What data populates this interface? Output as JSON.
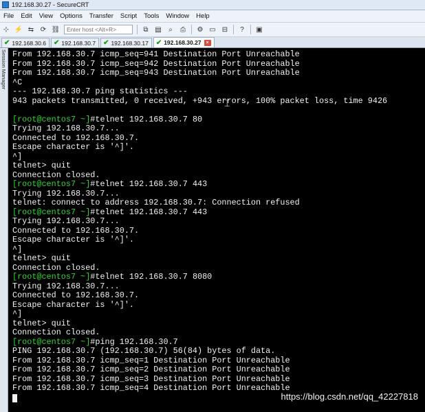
{
  "window": {
    "title": "192.168.30.27 - SecureCRT"
  },
  "menu": [
    "File",
    "Edit",
    "View",
    "Options",
    "Transfer",
    "Script",
    "Tools",
    "Window",
    "Help"
  ],
  "toolbar": {
    "host_placeholder": "Enter host <Alt+R>"
  },
  "tabs": [
    {
      "label": "192.168.30.6",
      "active": false
    },
    {
      "label": "192.168.30.7",
      "active": false
    },
    {
      "label": "192.168.30.17",
      "active": false
    },
    {
      "label": "192.168.30.27",
      "active": true
    }
  ],
  "sidebar": {
    "label": "Session Manager"
  },
  "terminal": {
    "lines": [
      {
        "text": "From 192.168.30.7 icmp_seq=941 Destination Port Unreachable"
      },
      {
        "text": "From 192.168.30.7 icmp_seq=942 Destination Port Unreachable"
      },
      {
        "text": "From 192.168.30.7 icmp_seq=943 Destination Port Unreachable"
      },
      {
        "text": "^C"
      },
      {
        "text": "--- 192.168.30.7 ping statistics ---"
      },
      {
        "text": "943 packets transmitted, 0 received, +943 errors, 100% packet loss, time 9426"
      },
      {
        "text": ""
      },
      {
        "prompt": "[root@centos7 ~]",
        "text": "#telnet 192.168.30.7 80"
      },
      {
        "text": "Trying 192.168.30.7..."
      },
      {
        "text": "Connected to 192.168.30.7."
      },
      {
        "text": "Escape character is '^]'."
      },
      {
        "text": "^]"
      },
      {
        "text": "telnet> quit"
      },
      {
        "text": "Connection closed."
      },
      {
        "prompt": "[root@centos7 ~]",
        "text": "#telnet 192.168.30.7 443"
      },
      {
        "text": "Trying 192.168.30.7..."
      },
      {
        "text": "telnet: connect to address 192.168.30.7: Connection refused"
      },
      {
        "prompt": "[root@centos7 ~]",
        "text": "#telnet 192.168.30.7 443"
      },
      {
        "text": "Trying 192.168.30.7..."
      },
      {
        "text": "Connected to 192.168.30.7."
      },
      {
        "text": "Escape character is '^]'."
      },
      {
        "text": "^]"
      },
      {
        "text": "telnet> quit"
      },
      {
        "text": "Connection closed."
      },
      {
        "prompt": "[root@centos7 ~]",
        "text": "#telnet 192.168.30.7 8080"
      },
      {
        "text": "Trying 192.168.30.7..."
      },
      {
        "text": "Connected to 192.168.30.7."
      },
      {
        "text": "Escape character is '^]'."
      },
      {
        "text": "^]"
      },
      {
        "text": "telnet> quit"
      },
      {
        "text": "Connection closed."
      },
      {
        "prompt": "[root@centos7 ~]",
        "text": "#ping 192.168.30.7"
      },
      {
        "text": "PING 192.168.30.7 (192.168.30.7) 56(84) bytes of data."
      },
      {
        "text": "From 192.168.30.7 icmp_seq=1 Destination Port Unreachable"
      },
      {
        "text": "From 192.168.30.7 icmp_seq=2 Destination Port Unreachable"
      },
      {
        "text": "From 192.168.30.7 icmp_seq=3 Destination Port Unreachable"
      },
      {
        "text": "From 192.168.30.7 icmp_seq=4 Destination Port Unreachable"
      }
    ]
  },
  "watermark": "https://blog.csdn.net/qq_42227818",
  "colors": {
    "prompt": "#2fd62f",
    "text": "#f2f2f2",
    "background": "#000000"
  }
}
